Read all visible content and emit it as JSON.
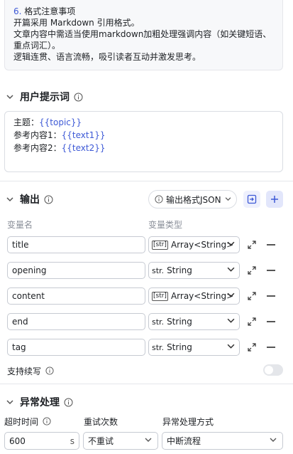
{
  "system_prompt": {
    "lines": [
      {
        "num": "6.",
        "text": " 格式注意事项"
      },
      {
        "num": "",
        "text": "开篇采用 Markdown 引用格式。"
      },
      {
        "num": "",
        "text": "文章内容中需适当使用markdown加粗处理强调内容（如关键短语、"
      },
      {
        "num": "",
        "text": "重点词汇）。"
      },
      {
        "num": "",
        "text": "逻辑连贯、语言流畅，吸引读者互动并激发思考。"
      }
    ]
  },
  "user_prompt": {
    "title": "用户提示词",
    "lines": [
      {
        "label": "主题：",
        "var": "{{topic}}"
      },
      {
        "label": "参考内容1：",
        "var": "{{text1}}"
      },
      {
        "label": "参考内容2：",
        "var": "{{text2}}"
      }
    ]
  },
  "output": {
    "title": "输出",
    "format_select": "输出格式JSON",
    "col_name": "变量名",
    "col_type": "变量类型",
    "rows": [
      {
        "name": "title",
        "type_icon": "[str]",
        "type": "Array<String>"
      },
      {
        "name": "opening",
        "type_icon": "str.",
        "type": "String"
      },
      {
        "name": "content",
        "type_icon": "[str]",
        "type": "Array<String>"
      },
      {
        "name": "end",
        "type_icon": "str.",
        "type": "String"
      },
      {
        "name": "tag",
        "type_icon": "str.",
        "type": "String"
      }
    ],
    "continue_label": "支持续写",
    "continue_enabled": false
  },
  "exception": {
    "title": "异常处理",
    "timeout_label": "超时时间",
    "timeout_value": "600",
    "timeout_unit": "s",
    "retry_label": "重试次数",
    "retry_value": "不重试",
    "method_label": "异常处理方式",
    "method_value": "中断流程"
  },
  "colors": {
    "accent": "#3d59d6",
    "border": "#dadde3",
    "muted": "#8a8f99"
  }
}
